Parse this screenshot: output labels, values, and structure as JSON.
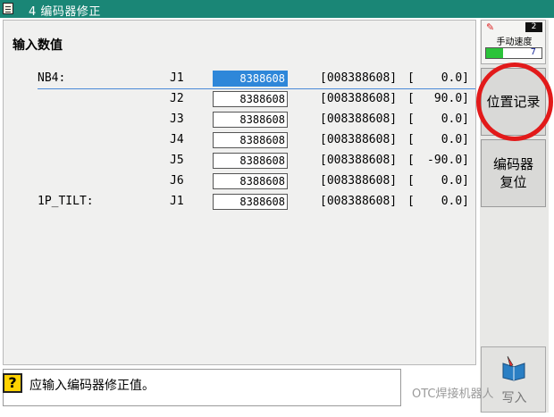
{
  "window": {
    "title": "4 编码器修正"
  },
  "section": {
    "heading": "输入数值"
  },
  "rows": [
    {
      "label": "NB4:",
      "axis": "J1",
      "value": "8388608",
      "raw": "[008388608]",
      "bracket": "[",
      "angle": "0.0]",
      "selected": true
    },
    {
      "label": "",
      "axis": "J2",
      "value": "8388608",
      "raw": "[008388608]",
      "bracket": "[",
      "angle": "90.0]"
    },
    {
      "label": "",
      "axis": "J3",
      "value": "8388608",
      "raw": "[008388608]",
      "bracket": "[",
      "angle": "0.0]"
    },
    {
      "label": "",
      "axis": "J4",
      "value": "8388608",
      "raw": "[008388608]",
      "bracket": "[",
      "angle": "0.0]"
    },
    {
      "label": "",
      "axis": "J5",
      "value": "8388608",
      "raw": "[008388608]",
      "bracket": "[",
      "angle": "-90.0]"
    },
    {
      "label": "",
      "axis": "J6",
      "value": "8388608",
      "raw": "[008388608]",
      "bracket": "[",
      "angle": "0.0]"
    },
    {
      "label": "1P_TILT:",
      "axis": "J1",
      "value": "8388608",
      "raw": "[008388608]",
      "bracket": "[",
      "angle": "0.0]"
    }
  ],
  "speed_panel": {
    "mode_number": "2",
    "label": "手动速度",
    "level": "7",
    "fill_fraction": 0.3,
    "fill_color": "#2bc33a"
  },
  "buttons": {
    "position_record": "位置记录",
    "encoder_reset_line1": "编码器",
    "encoder_reset_line2": "复位",
    "bottom": "写入"
  },
  "message": {
    "text": "应输入编码器修正值。"
  },
  "watermark": {
    "text": "OTC焊接机器人"
  },
  "colors": {
    "titlebar": "#1a8676",
    "selection": "#2e87d9",
    "annotation_circle": "#e21a1a"
  }
}
